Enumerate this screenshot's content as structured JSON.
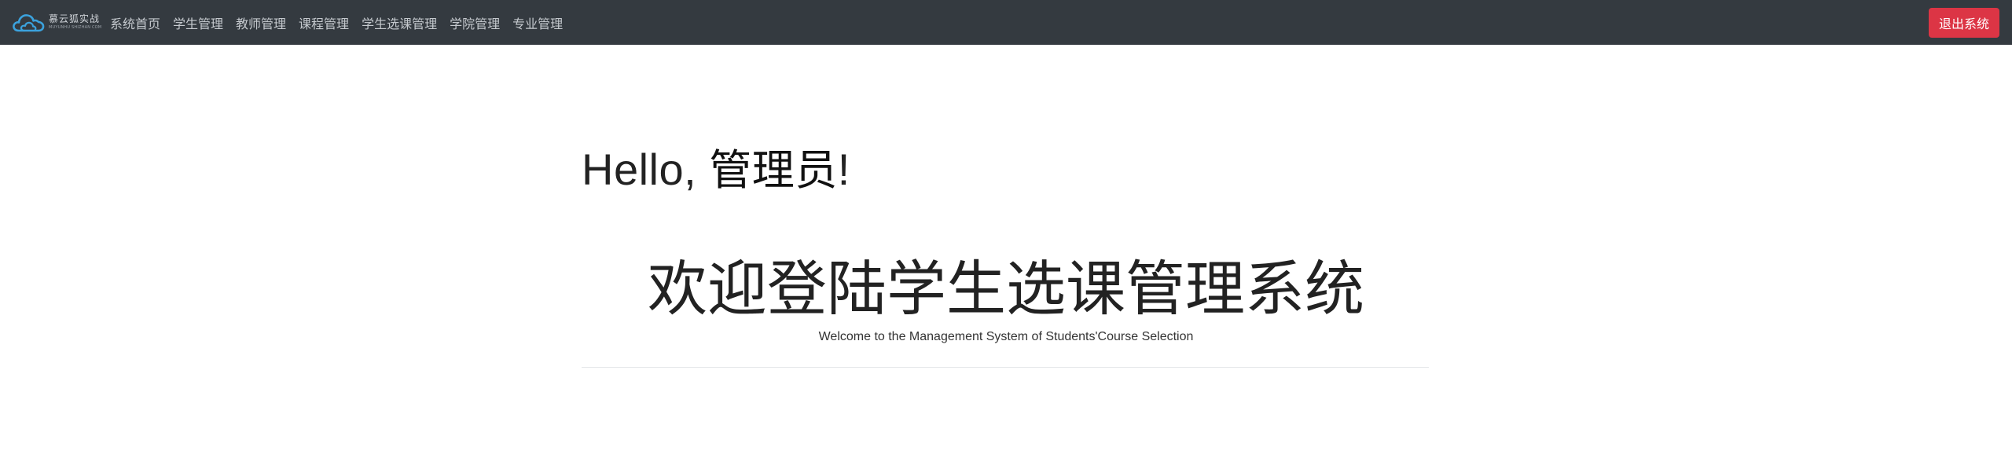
{
  "navbar": {
    "brand": {
      "logo_icon": "cloud-icon",
      "name": "慕云狐实战",
      "tagline": "MUYUNHU SHIZHAN COM"
    },
    "items": [
      {
        "label": "系统首页"
      },
      {
        "label": "学生管理"
      },
      {
        "label": "教师管理"
      },
      {
        "label": "课程管理"
      },
      {
        "label": "学生选课管理"
      },
      {
        "label": "学院管理"
      },
      {
        "label": "专业管理"
      }
    ],
    "logout_label": "退出系统",
    "background_color": "#343a40",
    "logout_color": "#dc3545",
    "logo_color": "#3ba2dd"
  },
  "main": {
    "greeting_prefix": "Hello, ",
    "greeting_user": "管理员",
    "greeting_suffix": "!",
    "title": "欢迎登陆学生选课管理系统",
    "subtitle": "Welcome to the Management System of Students'Course Selection"
  }
}
